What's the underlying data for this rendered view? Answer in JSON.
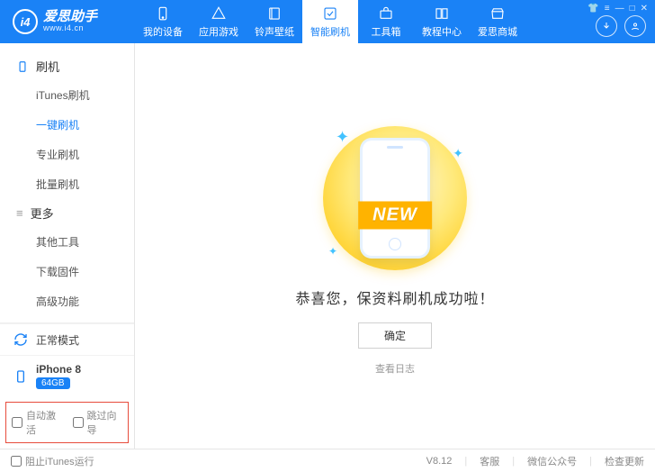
{
  "app": {
    "logo_text": "i4",
    "name": "爱思助手",
    "site": "www.i4.cn"
  },
  "nav": {
    "items": [
      {
        "label": "我的设备"
      },
      {
        "label": "应用游戏"
      },
      {
        "label": "铃声壁纸"
      },
      {
        "label": "智能刷机"
      },
      {
        "label": "工具箱"
      },
      {
        "label": "教程中心"
      },
      {
        "label": "爱思商城"
      }
    ],
    "active_index": 3
  },
  "sidebar": {
    "groups": [
      {
        "title": "刷机",
        "items": [
          "iTunes刷机",
          "一键刷机",
          "专业刷机",
          "批量刷机"
        ],
        "active_index": 1
      },
      {
        "title": "更多",
        "items": [
          "其他工具",
          "下载固件",
          "高级功能"
        ]
      }
    ],
    "mode": "正常模式",
    "device_name": "iPhone 8",
    "device_capacity": "64GB",
    "auto_activate_label": "自动激活",
    "skip_wizard_label": "跳过向导"
  },
  "main": {
    "ribbon": "NEW",
    "success_text": "恭喜您，保资料刷机成功啦！",
    "ok_button": "确定",
    "view_log": "查看日志"
  },
  "footer": {
    "block_itunes": "阻止iTunes运行",
    "version": "V8.12",
    "links": [
      "客服",
      "微信公众号",
      "检查更新"
    ]
  }
}
